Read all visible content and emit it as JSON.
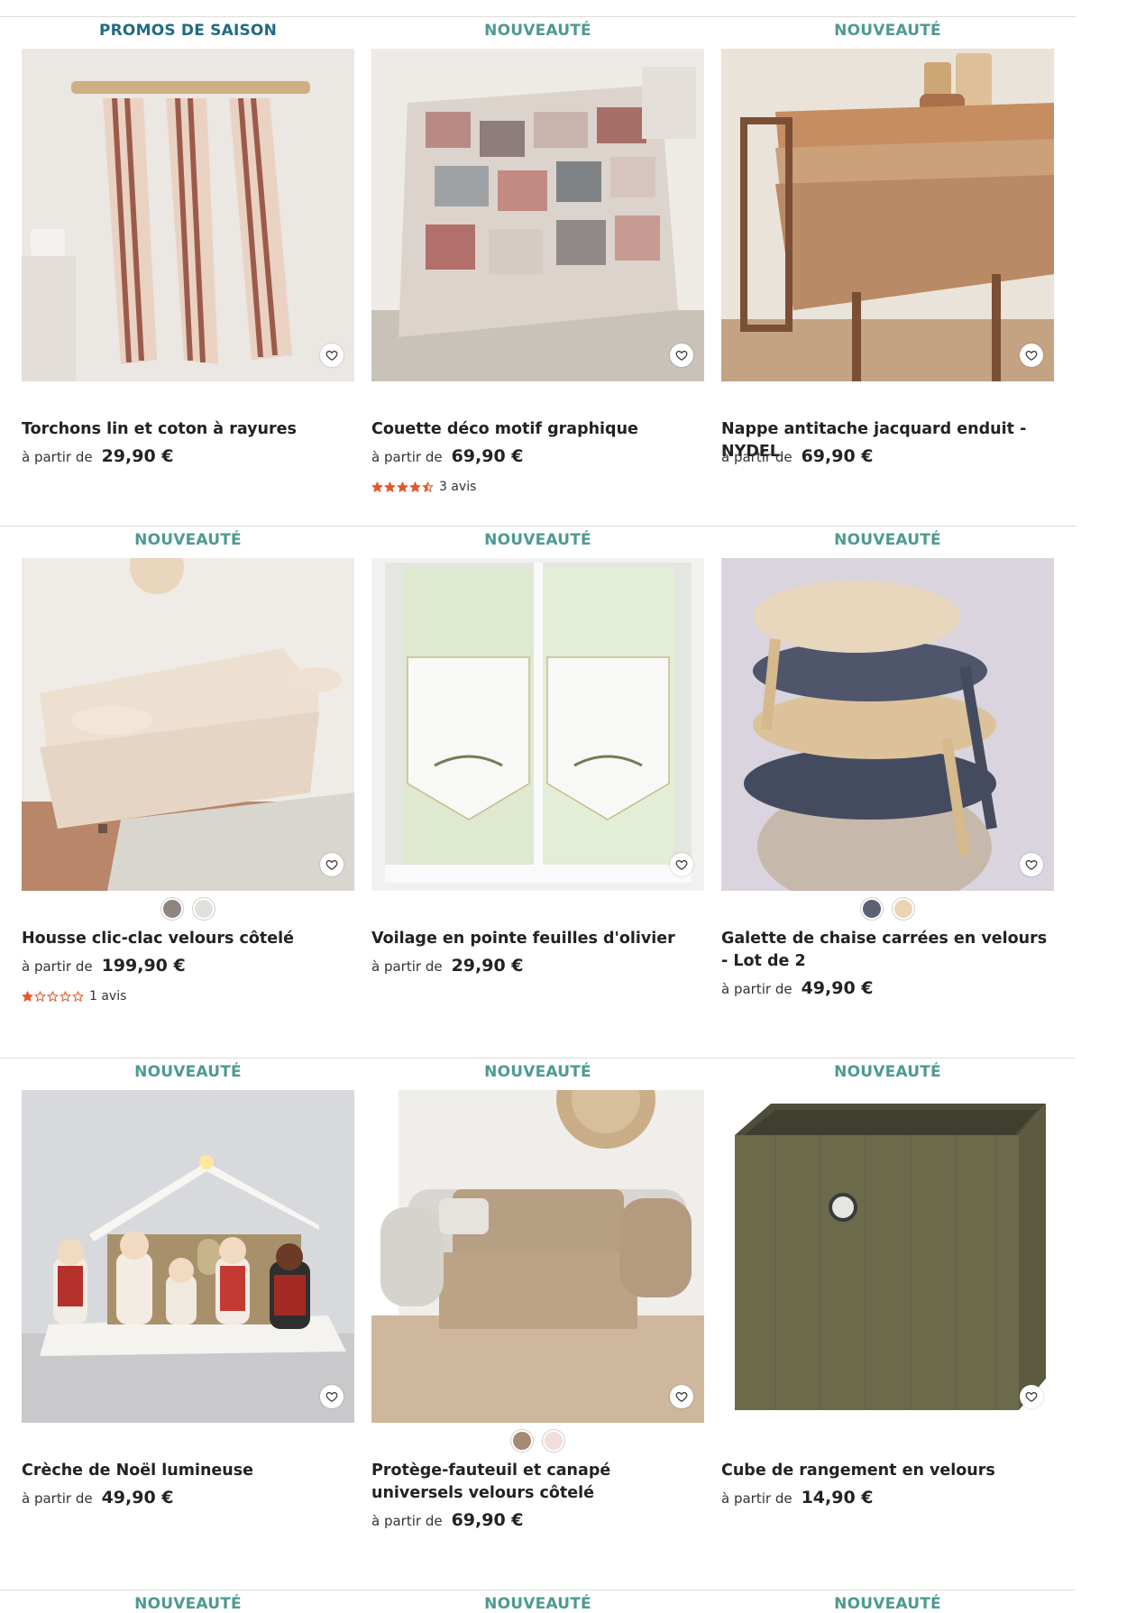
{
  "products": [
    {
      "badge": "PROMOS DE SAISON",
      "title": "Torchons lin et coton à rayures",
      "price_prefix": "à partir de",
      "price": "29,90 €",
      "image": "hanging striped tea towels",
      "swatches": [],
      "rating": null,
      "reviews": ""
    },
    {
      "badge": "NOUVEAUTÉ",
      "title": "Couette déco motif graphique",
      "price_prefix": "à partir de",
      "price": "69,90 €",
      "image": "patchwork duvet on bed",
      "swatches": [],
      "rating": 4.5,
      "reviews": "3 avis"
    },
    {
      "badge": "NOUVEAUTÉ",
      "title": "Nappe antitache jacquard enduit - NYDEL",
      "price_prefix": "à partir de",
      "price": "69,90 €",
      "image": "jacquard tablecloth on table",
      "swatches": [],
      "rating": null,
      "reviews": ""
    },
    {
      "badge": "NOUVEAUTÉ",
      "title": "Housse clic-clac velours côtelé",
      "price_prefix": "à partir de",
      "price": "199,90 €",
      "image": "beige corduroy sofa bed",
      "swatches": [
        "#8e8580",
        "#dfe1dc"
      ],
      "rating": 1,
      "reviews": "1 avis"
    },
    {
      "badge": "NOUVEAUTÉ",
      "title": "Voilage en pointe feuilles d'olivier",
      "price_prefix": "à partir de",
      "price": "29,90 €",
      "image": "white window sheers with olive leaves",
      "swatches": [],
      "rating": null,
      "reviews": ""
    },
    {
      "badge": "NOUVEAUTÉ",
      "title": "Galette de chaise carrées en velours - Lot de 2",
      "price_prefix": "à partir de",
      "price": "49,90 €",
      "image": "stacked velvet chair cushions",
      "swatches": [
        "#5d6173",
        "#ead4b2"
      ],
      "rating": null,
      "reviews": ""
    },
    {
      "badge": "NOUVEAUTÉ",
      "title": "Crèche de Noël lumineuse",
      "price_prefix": "à partir de",
      "price": "49,90 €",
      "image": "illuminated nativity scene",
      "swatches": [],
      "rating": null,
      "reviews": ""
    },
    {
      "badge": "NOUVEAUTÉ",
      "title": "Protège-fauteuil et canapé universels velours côtelé",
      "price_prefix": "à partir de",
      "price": "69,90 €",
      "image": "sofa with corduroy protector",
      "swatches": [
        "#a88a74",
        "#f3dcdc"
      ],
      "rating": null,
      "reviews": ""
    },
    {
      "badge": "NOUVEAUTÉ",
      "title": "Cube de rangement en velours",
      "price_prefix": "à partir de",
      "price": "14,90 €",
      "image": "olive velvet storage cube",
      "swatches": [],
      "rating": null,
      "reviews": ""
    }
  ],
  "colors": {
    "badge": "#4e9a92",
    "promo_badge": "#1f6b84",
    "star": "#e2592a"
  },
  "icons": {
    "favorite": "heart-outline-icon",
    "rating": "star-icon"
  }
}
